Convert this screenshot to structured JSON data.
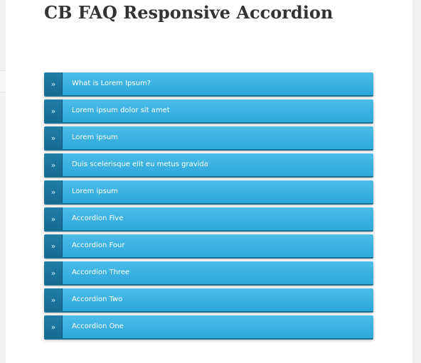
{
  "page": {
    "title": "CB FAQ Responsive Accordion"
  },
  "accordion": {
    "icon": "double-chevron-right-icon",
    "colors": {
      "bar": "#35ace0",
      "icon_box": "#1b739b"
    },
    "items": [
      {
        "label": "What is Lorem Ipsum?"
      },
      {
        "label": "Lorem ipsum dolor sit amet"
      },
      {
        "label": "Lorem ipsum"
      },
      {
        "label": "Duis scelerisque elit eu metus gravida"
      },
      {
        "label": "Lorem ipsum"
      },
      {
        "label": "Accordion Five"
      },
      {
        "label": "Accordion Four"
      },
      {
        "label": "Accordion Three"
      },
      {
        "label": "Accordion Two"
      },
      {
        "label": "Accordion One"
      }
    ]
  }
}
